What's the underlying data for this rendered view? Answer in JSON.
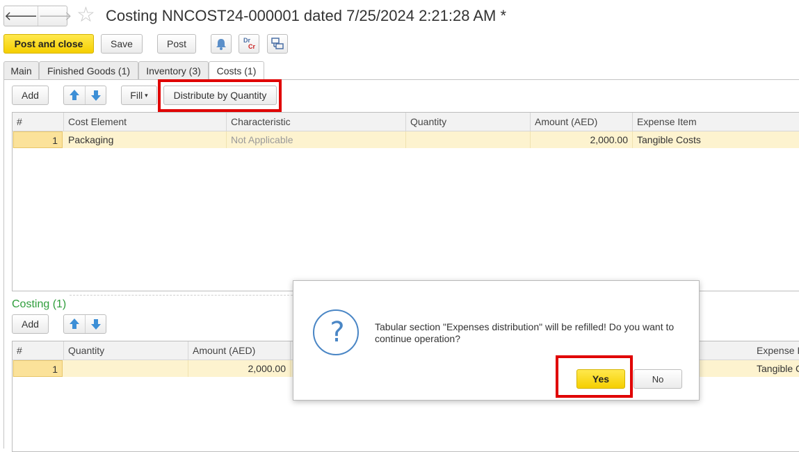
{
  "window": {
    "title": "Costing NNCOST24-000001 dated 7/25/2024 2:21:28 AM *",
    "back_glyph": "🡐",
    "forward_glyph": "🡒",
    "star_glyph": "☆"
  },
  "toolbar": {
    "post_and_close": "Post and close",
    "save": "Save",
    "post": "Post",
    "icons": [
      "bell-icon",
      "dr-cr-icon",
      "structure-icon"
    ],
    "dr_label": "Dr",
    "cr_label": "Cr"
  },
  "tabs": [
    {
      "label": "Main"
    },
    {
      "label": "Finished Goods (1)"
    },
    {
      "label": "Inventory (3)"
    },
    {
      "label": "Costs (1)",
      "active": true
    }
  ],
  "costs": {
    "add": "Add",
    "fill": "Fill",
    "fill_arrow": "▾",
    "distribute": "Distribute by Quantity",
    "columns": [
      "#",
      "Cost Element",
      "Characteristic",
      "Quantity",
      "Amount (AED)",
      "Expense Item"
    ],
    "rows": [
      {
        "n": "1",
        "cost_element": "Packaging",
        "characteristic": "Not Applicable",
        "quantity": "",
        "amount": "2,000.00",
        "expense_item": "Tangible Costs"
      }
    ]
  },
  "costing": {
    "title": "Costing (1)",
    "add": "Add",
    "columns": [
      "#",
      "Quantity",
      "Amount (AED)",
      "Expense I"
    ],
    "rows": [
      {
        "n": "1",
        "quantity": "",
        "amount": "2,000.00",
        "expense_item": "Tangible C"
      }
    ]
  },
  "dialog": {
    "icon": "question-icon",
    "question_glyph": "?",
    "message": "Tabular section \"Expenses distribution\" will be refilled! Do you want to continue operation?",
    "yes": "Yes",
    "no": "No"
  },
  "colors": {
    "accent_yellow": "#f5cf00",
    "highlight_red": "#e00000",
    "section_green": "#2e9d3b",
    "row_selected": "#fdf3cf",
    "info_blue": "#4a86c5"
  }
}
